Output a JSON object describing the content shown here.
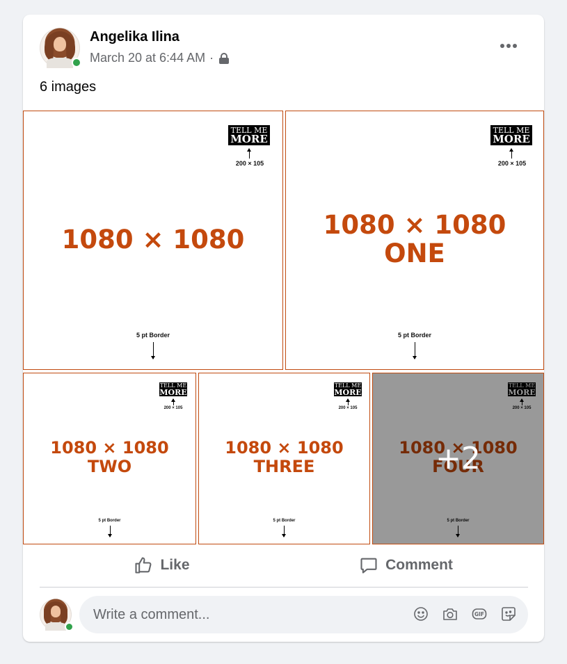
{
  "post": {
    "author": "Angelika Ilina",
    "timestamp": "March 20 at 6:44 AM",
    "meta_separator": "·",
    "privacy_icon": "lock-icon",
    "more_icon": "more-options-icon",
    "text": "6 images"
  },
  "images": [
    {
      "badge_line1": "TELL ME",
      "badge_line2": "MORE",
      "badge_size": "200 × 105",
      "lines": [
        "1080 × 1080"
      ],
      "border_label": "5 pt Border"
    },
    {
      "badge_line1": "TELL ME",
      "badge_line2": "MORE",
      "badge_size": "200 × 105",
      "lines": [
        "1080 × 1080",
        "ONE"
      ],
      "border_label": "5 pt Border"
    },
    {
      "badge_line1": "TELL ME",
      "badge_line2": "MORE",
      "badge_size": "200 × 105",
      "lines": [
        "1080 × 1080",
        "TWO"
      ],
      "border_label": "5 pt Border"
    },
    {
      "badge_line1": "TELL ME",
      "badge_line2": "MORE",
      "badge_size": "200 × 105",
      "lines": [
        "1080 × 1080",
        "THREE"
      ],
      "border_label": "5 pt Border"
    },
    {
      "badge_line1": "TELL ME",
      "badge_line2": "MORE",
      "badge_size": "200 × 105",
      "lines": [
        "1080 × 1080",
        "FOUR"
      ],
      "border_label": "5 pt Border",
      "overlay": "+2"
    }
  ],
  "actions": {
    "like_label": "Like",
    "like_icon": "thumbs-up-icon",
    "comment_label": "Comment",
    "comment_icon": "speech-bubble-icon"
  },
  "comment_composer": {
    "placeholder": "Write a comment...",
    "icons": [
      "emoji-icon",
      "camera-icon",
      "gif-icon",
      "sticker-icon"
    ]
  },
  "colors": {
    "accent_orange": "#c4490d",
    "online_green": "#31a24c",
    "muted_text": "#65676b",
    "page_background": "#f0f2f5"
  }
}
